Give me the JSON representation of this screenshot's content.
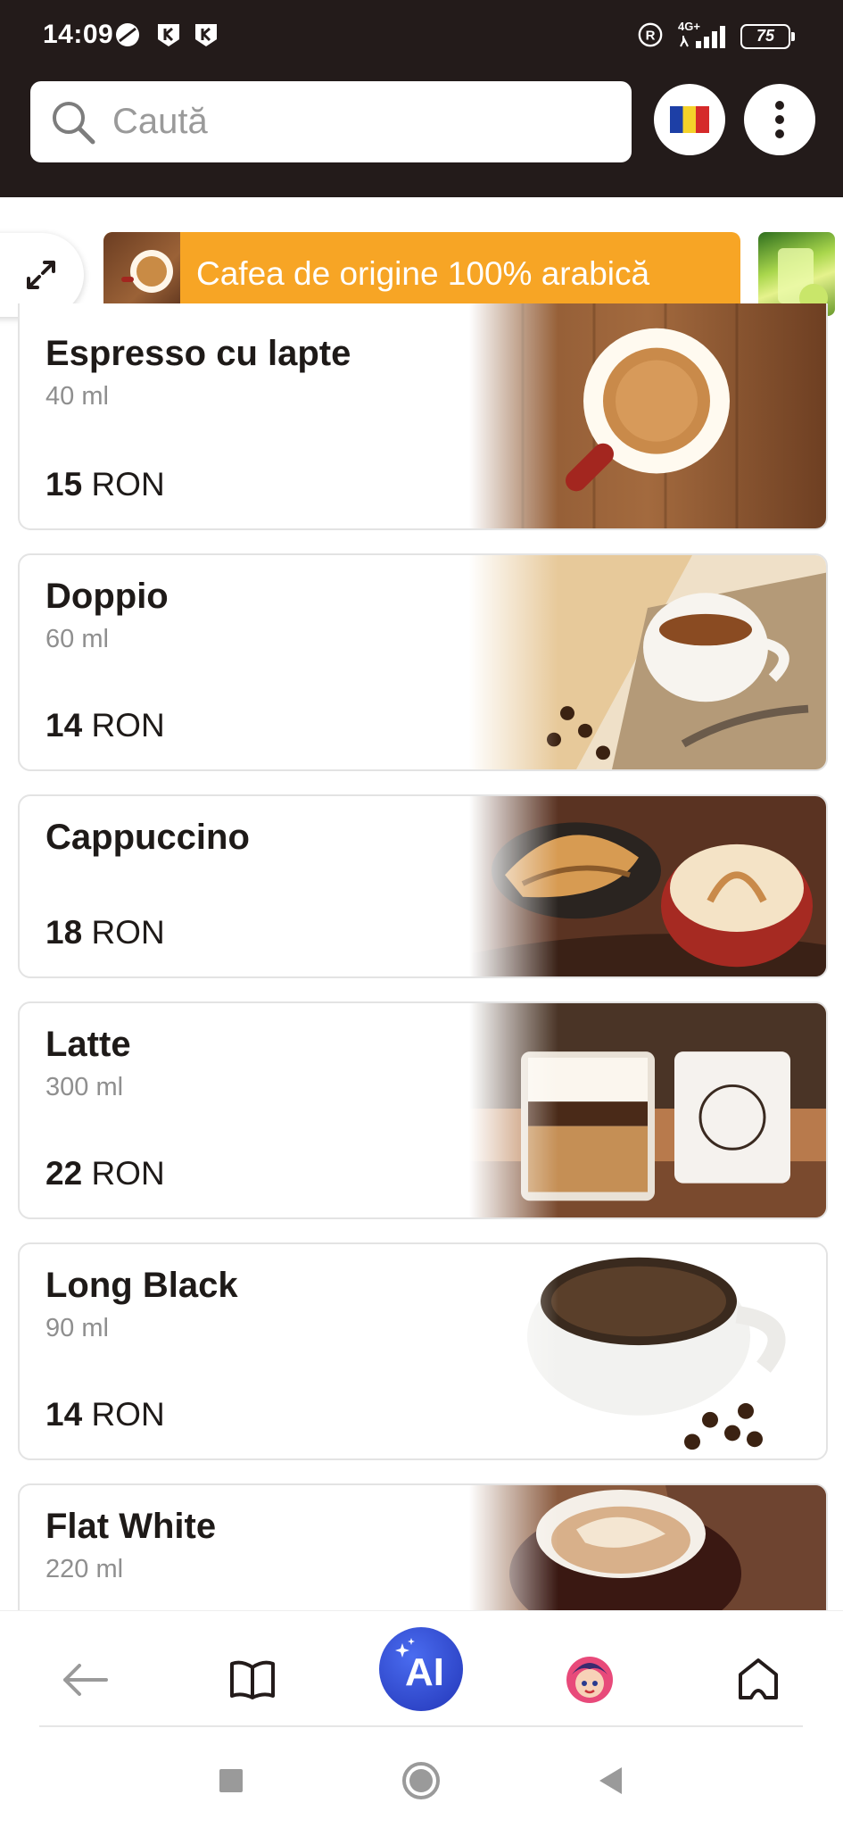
{
  "status_bar": {
    "time": "14:09",
    "network": "4G+",
    "battery": "75"
  },
  "header": {
    "search_placeholder": "Caută"
  },
  "category_strip": {
    "active_banner": "Cafea de origine 100% arabică"
  },
  "menu_items": [
    {
      "name": "Espresso cu lapte",
      "volume": "40 ml",
      "price": "15",
      "currency": "RON"
    },
    {
      "name": "Doppio",
      "volume": "60 ml",
      "price": "14",
      "currency": "RON"
    },
    {
      "name": "Cappuccino",
      "volume": "",
      "price": "18",
      "currency": "RON"
    },
    {
      "name": "Latte",
      "volume": "300 ml",
      "price": "22",
      "currency": "RON"
    },
    {
      "name": "Long Black",
      "volume": "90 ml",
      "price": "14",
      "currency": "RON"
    },
    {
      "name": "Flat White",
      "volume": "220 ml",
      "price": "",
      "currency": ""
    }
  ],
  "bottom_nav": {
    "ai_label": "AI"
  },
  "colors": {
    "header_bg": "#231b1a",
    "banner_bg": "#f7a525",
    "ai_button": "#2f4ad8"
  }
}
